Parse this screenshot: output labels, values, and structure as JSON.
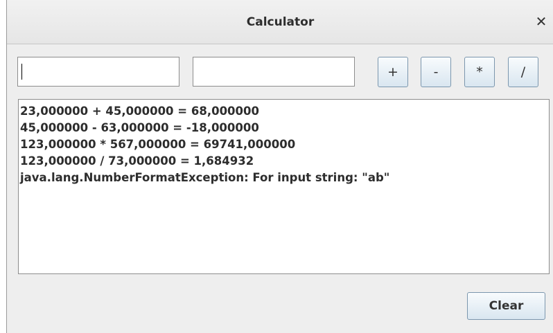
{
  "window": {
    "title": "Calculator",
    "close_glyph": "✕",
    "close_icon": "close-icon"
  },
  "inputs": {
    "first_value": "",
    "second_value": ""
  },
  "operators": {
    "add": "+",
    "subtract": "-",
    "multiply": "*",
    "divide": "/"
  },
  "output": {
    "lines": [
      "23,000000 + 45,000000 = 68,000000",
      "45,000000 - 63,000000 = -18,000000",
      "123,000000 * 567,000000 = 69741,000000",
      "123,000000 / 73,000000 = 1,684932",
      "java.lang.NumberFormatException: For input string: \"ab\""
    ]
  },
  "actions": {
    "clear_label": "Clear"
  },
  "colors": {
    "button_border": "#7b96ad",
    "window_bg": "#eeeeee"
  }
}
